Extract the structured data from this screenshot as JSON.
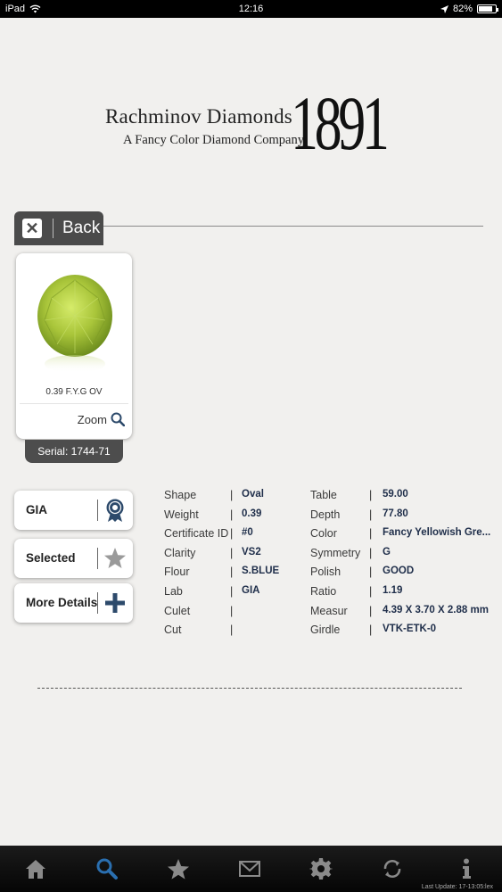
{
  "status_bar": {
    "carrier": "iPad",
    "time": "12:16",
    "battery_percent": "82%",
    "battery_level": 0.82
  },
  "logo": {
    "name": "Rachminov Diamonds",
    "tagline": "A Fancy Color Diamond Company",
    "year": "1891"
  },
  "back_tab": {
    "label": "Back"
  },
  "diamond_card": {
    "caption": "0.39  F.Y.G  OV",
    "zoom_label": "Zoom",
    "serial": "Serial: 1744-71",
    "gem_color": "#a9c53a"
  },
  "actions": [
    {
      "label": "GIA",
      "icon": "gia-ribbon-icon"
    },
    {
      "label": "Selected",
      "icon": "star-icon"
    },
    {
      "label": "More Details",
      "icon": "plus-icon"
    }
  ],
  "specs_left": [
    {
      "label": "Shape",
      "value": "Oval"
    },
    {
      "label": "Weight",
      "value": "0.39"
    },
    {
      "label": "Certificate ID",
      "value": "#0"
    },
    {
      "label": "Clarity",
      "value": "VS2"
    },
    {
      "label": "Flour",
      "value": "S.BLUE"
    },
    {
      "label": "Lab",
      "value": "GIA"
    },
    {
      "label": "Culet",
      "value": ""
    },
    {
      "label": "Cut",
      "value": ""
    }
  ],
  "specs_right": [
    {
      "label": "Table",
      "value": "59.00"
    },
    {
      "label": "Depth",
      "value": "77.80"
    },
    {
      "label": "Color",
      "value": "Fancy Yellowish Gre..."
    },
    {
      "label": "Symmetry",
      "value": "G"
    },
    {
      "label": "Polish",
      "value": "GOOD"
    },
    {
      "label": "Ratio",
      "value": "1.19"
    },
    {
      "label": "Measur",
      "value": "4.39 X 3.70 X 2.88 mm"
    },
    {
      "label": "Girdle",
      "value": "VTK-ETK-0"
    }
  ],
  "tab_bar": {
    "tabs": [
      {
        "name": "home",
        "icon": "home-icon",
        "active": false
      },
      {
        "name": "search",
        "icon": "search-icon",
        "active": true
      },
      {
        "name": "favorites",
        "icon": "star-icon",
        "active": false
      },
      {
        "name": "mail",
        "icon": "mail-icon",
        "active": false
      },
      {
        "name": "settings",
        "icon": "gear-icon",
        "active": false
      },
      {
        "name": "sync",
        "icon": "sync-icon",
        "active": false
      },
      {
        "name": "info",
        "icon": "info-icon",
        "active": false
      }
    ],
    "last_update": "Last Update: 17-13:05:lex",
    "active_color": "#2a6fb0",
    "inactive_color": "#8a8a8a"
  }
}
